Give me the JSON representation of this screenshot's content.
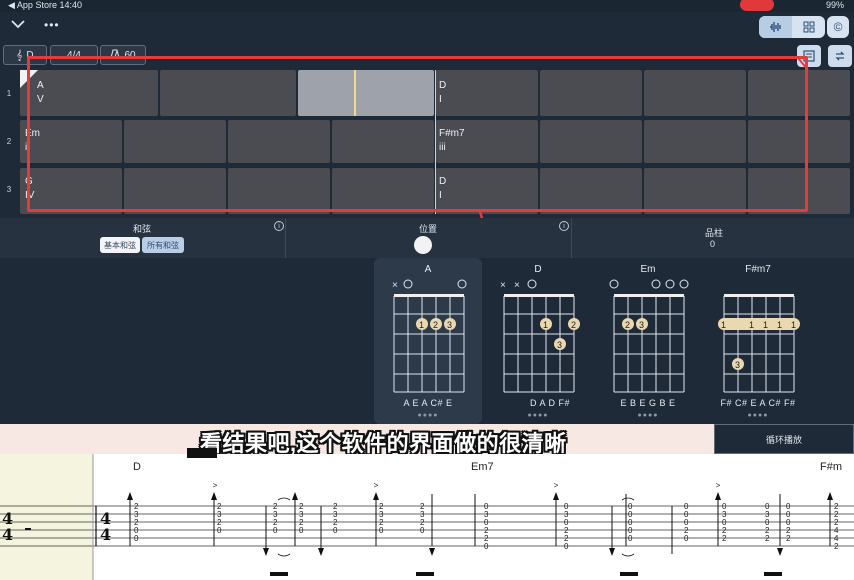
{
  "status": {
    "left": "◀ App Store  14:40",
    "right": "99%"
  },
  "header": {
    "back_icon": "chevron-down-icon",
    "more_label": "•••",
    "seg_options": [
      "waveform-icon",
      "grid-icon"
    ],
    "c_label": "©"
  },
  "toolbar": {
    "key_label": "D",
    "time_sig": "4/4",
    "tempo": "60"
  },
  "grid": {
    "rows": [
      {
        "num": "1",
        "cells": [
          {
            "chord": "A",
            "roman": "V"
          },
          {
            "chord": "D",
            "roman": "I"
          }
        ]
      },
      {
        "num": "2",
        "cells": [
          {
            "chord": "Em",
            "roman": "ii"
          },
          {
            "chord": "F#m7",
            "roman": "iii"
          }
        ]
      },
      {
        "num": "3",
        "cells": [
          {
            "chord": "G",
            "roman": "IV"
          },
          {
            "chord": "D",
            "roman": "I"
          }
        ]
      }
    ]
  },
  "panel": {
    "chord_title": "和弦",
    "basic_chords": "基本和弦",
    "all_chords": "所有和弦",
    "position_title": "位置",
    "fret_title": "品柱",
    "fret_value": "0"
  },
  "chords": [
    {
      "name": "A",
      "strings": "A E A C# E",
      "dots": "●●●●"
    },
    {
      "name": "D",
      "strings": "D A D F#",
      "dots": "●●●●"
    },
    {
      "name": "Em",
      "strings": "E B E G B E",
      "dots": "●●●●"
    },
    {
      "name": "F#m7",
      "strings": "F# C# E A C# F#",
      "dots": "●●●●"
    }
  ],
  "subtitle": "看结果吧,这个软件的界面做的很清晰",
  "loop_label": "循环播放",
  "score": {
    "chord_labels": [
      "D",
      "Em7",
      "F#m"
    ],
    "time_sig_top": "4",
    "time_sig_bottom": "4",
    "accent": ">"
  },
  "colors": {
    "accent_red": "#e43c3c",
    "bg": "#1f2a38",
    "cell": "#4a4c51"
  }
}
